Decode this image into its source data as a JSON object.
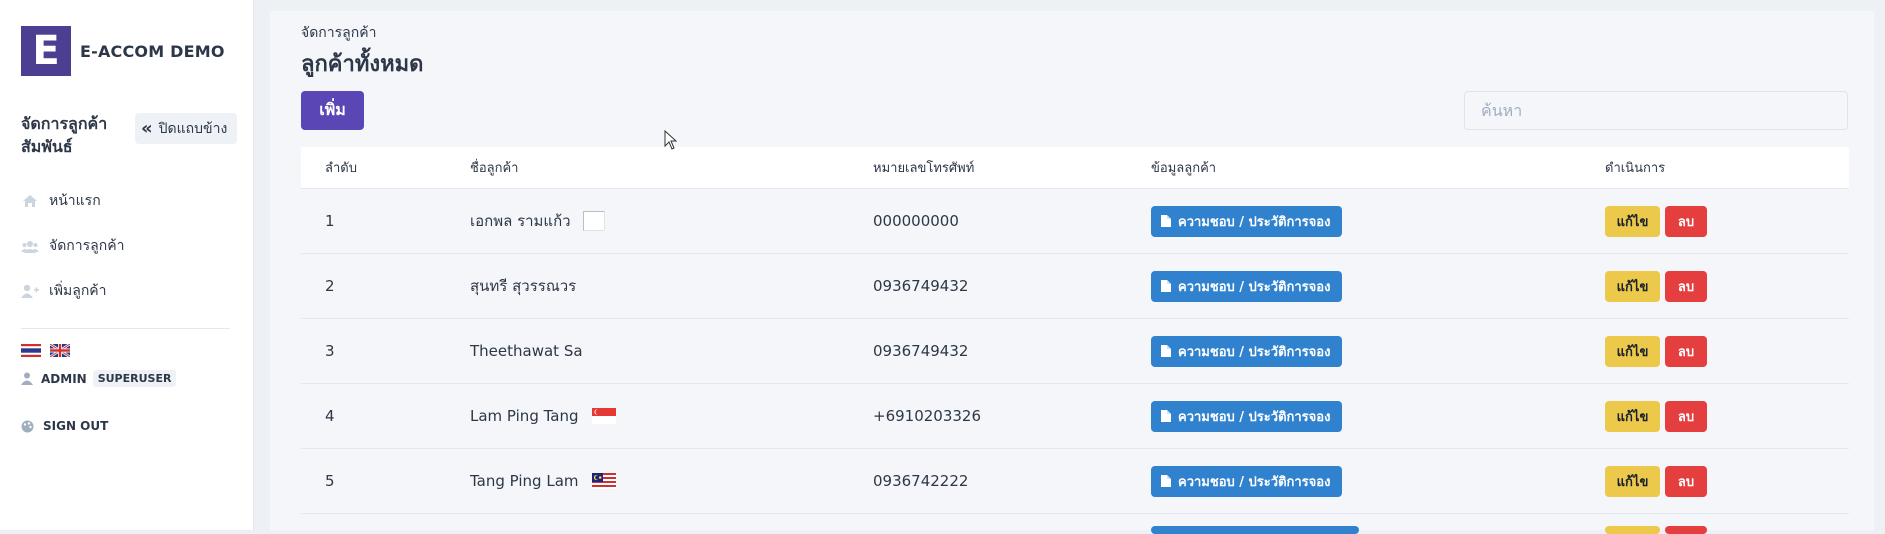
{
  "brand": {
    "logo_letter": "E",
    "name": "E-ACCOM DEMO",
    "logo_color": "#4c3f91"
  },
  "sidebar": {
    "section_title": "จัดการลูกค้าสัมพันธ์",
    "collapse_label": "ปิดแถบข้าง",
    "items": [
      {
        "label": "หน้าแรก",
        "icon": "home-icon"
      },
      {
        "label": "จัดการลูกค้า",
        "icon": "users-icon"
      },
      {
        "label": "เพิ่มลูกค้า",
        "icon": "user-plus-icon"
      }
    ],
    "languages": [
      "thai-flag",
      "uk-flag"
    ],
    "user": {
      "name": "ADMIN",
      "role": "SUPERUSER"
    },
    "signout_label": "SIGN OUT"
  },
  "header": {
    "breadcrumb": "จัดการลูกค้า",
    "title": "ลูกค้าทั้งหมด",
    "add_label": "เพิ่ม",
    "search_placeholder": "ค้นหา"
  },
  "table": {
    "columns": [
      "ลำดับ",
      "ชื่อลูกค้า",
      "หมายเลขโทรศัพท์",
      "ข้อมูลลูกค้า",
      "ดำเนินการ"
    ],
    "info_label": "ความชอบ / ประวัติการจอง",
    "edit_label": "แก้ไข",
    "delete_label": "ลบ",
    "rows": [
      {
        "no": "1",
        "name": "เอกพล  รามแก้ว",
        "flag": "broken-image",
        "phone": "000000000"
      },
      {
        "no": "2",
        "name": "สุนทรี  สุวรรณวร",
        "flag": "",
        "phone": "0936749432"
      },
      {
        "no": "3",
        "name": "Theethawat  Sa",
        "flag": "",
        "phone": "0936749432"
      },
      {
        "no": "4",
        "name": "Lam  Ping Tang",
        "flag": "singapore-flag",
        "phone": "+6910203326"
      },
      {
        "no": "5",
        "name": "Tang  Ping Lam",
        "flag": "malaysia-flag",
        "phone": "0936742222"
      }
    ]
  },
  "colors": {
    "primary": "#5a46b5",
    "info": "#3182ce",
    "warning": "#ecc94b",
    "danger": "#e53e3e"
  }
}
